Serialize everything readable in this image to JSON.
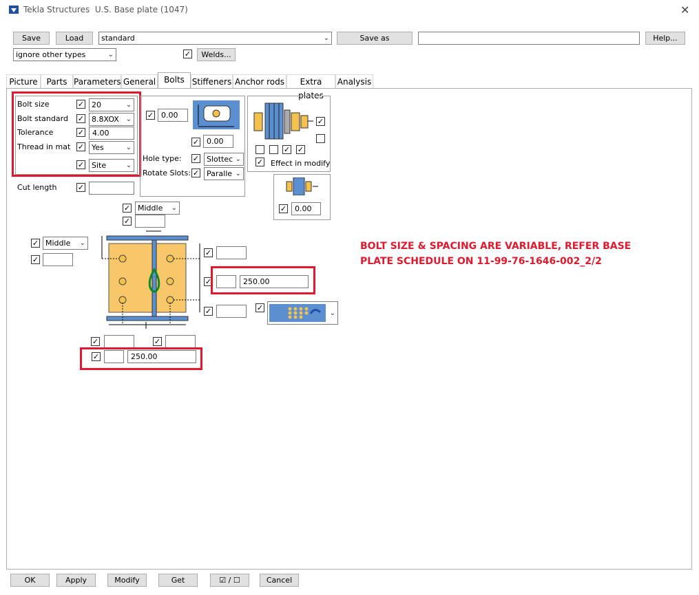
{
  "window": {
    "app_name": "Tekla Structures",
    "title": "U.S. Base plate (1047)"
  },
  "toolbar": {
    "save_label": "Save",
    "load_label": "Load",
    "preset_value": "standard",
    "save_as_label": "Save as",
    "save_as_value": "",
    "help_label": "Help...",
    "filter_value": "ignore other types",
    "welds_label": "Welds..."
  },
  "tabs": [
    "Picture",
    "Parts",
    "Parameters",
    "General",
    "Bolts",
    "Stiffeners",
    "Anchor rods",
    "Extra plates",
    "Analysis"
  ],
  "active_tab": "Bolts",
  "bolts": {
    "bolt_size_label": "Bolt size",
    "bolt_size_value": "20",
    "bolt_standard_label": "Bolt standard",
    "bolt_standard_value": "8.8XOX",
    "tolerance_label": "Tolerance",
    "tolerance_value": "4.00",
    "thread_label": "Thread in mat",
    "thread_value": "Yes",
    "site_value": "Site",
    "cut_length_label": "Cut length",
    "cut_length_value": ""
  },
  "hole": {
    "slot_x_value": "0.00",
    "slot_y_value": "0.00",
    "hole_type_label": "Hole type:",
    "hole_type_value": "Slottec",
    "rotate_label": "Rotate Slots:",
    "rotate_value": "Paralle"
  },
  "effect": {
    "label": "Effect in modify",
    "offset_value": "0.00"
  },
  "layout": {
    "top_pos_value": "Middle",
    "left_pos_value": "Middle",
    "vertical_spacing_value": "250.00",
    "horizontal_spacing_value": "250.00"
  },
  "note": {
    "line1": "BOLT SIZE & SPACING ARE VARIABLE, REFER BASE",
    "line2": "PLATE SCHEDULE ON 11-99-76-1646-002_2/2"
  },
  "footer": {
    "ok_label": "OK",
    "apply_label": "Apply",
    "modify_label": "Modify",
    "get_label": "Get",
    "toggle_label": "☑ / ☐",
    "cancel_label": "Cancel"
  }
}
